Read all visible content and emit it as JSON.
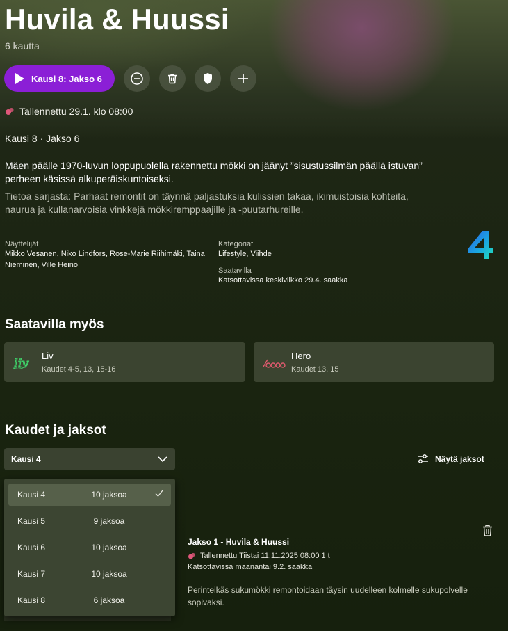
{
  "show": {
    "title": "Huvila & Huussi",
    "seasons_count": "6 kautta"
  },
  "actions": {
    "play_label": "Kausi 8: Jakso 6",
    "remove_icon": "minus-circle-icon",
    "delete_icon": "trash-icon",
    "shield_icon": "shield-icon",
    "add_icon": "plus-icon"
  },
  "recording": {
    "recorded_text": "Tallennettu 29.1. klo 08:00",
    "episode_line": "Kausi 8 · Jakso 6"
  },
  "description": {
    "episode": "Mäen päälle 1970-luvun loppupuolella rakennettu mökki on jäänyt ”sisustussilmän päällä istuvan” perheen käsissä alkuperäiskuntoiseksi.",
    "series": "Tietoa sarjasta: Parhaat remontit on täynnä paljastuksia kulissien takaa, ikimuistoisia kohteita, naurua ja kullanarvoisia vinkkejä mökkiremppaajille ja -puutarhureille."
  },
  "meta": {
    "actors_label": "Näyttelijät",
    "actors": "Mikko Vesanen, Niko Lindfors, Rose-Marie Riihimäki, Taina Nieminen, Ville Heino",
    "categories_label": "Kategoriat",
    "categories": "Lifestyle, Viihde",
    "available_label": "Saatavilla",
    "available": "Katsottavissa keskiviikko 29.4. saakka",
    "channel_logo": "4"
  },
  "also_available": {
    "heading": "Saatavilla myös",
    "channels": [
      {
        "name": "Liv",
        "seasons": "Kaudet 4-5, 13, 15-16",
        "logo_text": "liv"
      },
      {
        "name": "Hero",
        "seasons": "Kaudet 13, 15",
        "logo_text": "hero"
      }
    ]
  },
  "seasons": {
    "heading": "Kaudet ja jaksot",
    "selected": "Kausi 4",
    "show_episodes_label": "Näytä jaksot",
    "options": [
      {
        "season": "Kausi 4",
        "count": "10 jaksoa",
        "selected": true
      },
      {
        "season": "Kausi 5",
        "count": "9 jaksoa",
        "selected": false
      },
      {
        "season": "Kausi 6",
        "count": "10 jaksoa",
        "selected": false
      },
      {
        "season": "Kausi 7",
        "count": "10 jaksoa",
        "selected": false
      },
      {
        "season": "Kausi 8",
        "count": "6 jaksoa",
        "selected": false
      }
    ]
  },
  "episode": {
    "title": "Jakso 1 - Huvila & Huussi",
    "recorded": "Tallennettu Tiistai 11.11.2025 08:00  1 t",
    "available": "Katsottavissa maanantai 9.2. saakka",
    "description": "Perinteikäs sukumökki remontoidaan täysin uudelleen kolmelle sukupolvelle sopivaksi."
  },
  "colors": {
    "accent": "#8b1fd6",
    "recorded_dot": "#e0577a"
  }
}
